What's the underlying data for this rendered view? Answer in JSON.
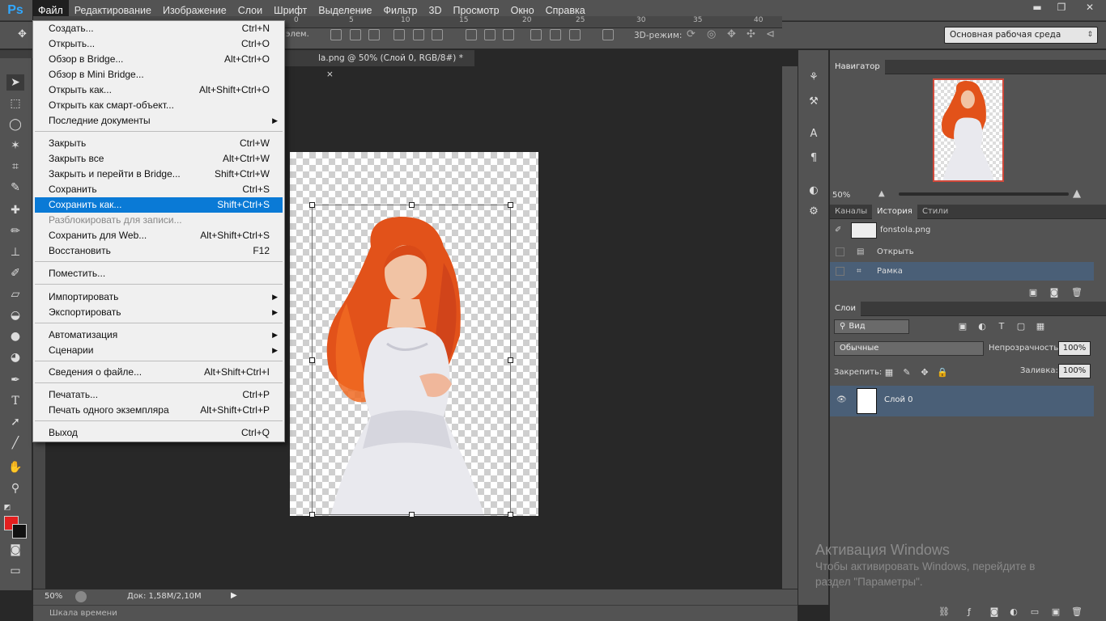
{
  "app": {
    "logo": "Ps"
  },
  "menubar": {
    "items": [
      "Файл",
      "Редактирование",
      "Изображение",
      "Слои",
      "Шрифт",
      "Выделение",
      "Фильтр",
      "3D",
      "Просмотр",
      "Окно",
      "Справка"
    ],
    "active_index": 0
  },
  "window_controls": {
    "minimize": "▬",
    "restore": "❐",
    "close": "✕"
  },
  "options_bar": {
    "elem_label": "элем.",
    "mode_3d_label": "3D-режим:",
    "workspace": "Основная рабочая среда"
  },
  "document": {
    "tab_title": "la.png @ 50% (Слой 0, RGB/8#) *",
    "tab_close": "×"
  },
  "rulers": {
    "h_ticks": [
      "0",
      "5",
      "10",
      "15",
      "20",
      "25",
      "30",
      "35",
      "40"
    ]
  },
  "status": {
    "zoom": "50%",
    "doc_info": "Док: 1,58M/2,10M"
  },
  "timeline": {
    "label": "Шкала времени"
  },
  "file_menu": {
    "items": [
      {
        "label": "Создать...",
        "shortcut": "Ctrl+N"
      },
      {
        "label": "Открыть...",
        "shortcut": "Ctrl+O"
      },
      {
        "label": "Обзор в Bridge...",
        "shortcut": "Alt+Ctrl+O"
      },
      {
        "label": "Обзор в Mini Bridge...",
        "shortcut": ""
      },
      {
        "label": "Открыть как...",
        "shortcut": "Alt+Shift+Ctrl+O"
      },
      {
        "label": "Открыть как смарт-объект...",
        "shortcut": ""
      },
      {
        "label": "Последние документы",
        "shortcut": "",
        "submenu": true
      },
      {
        "label": "Закрыть",
        "shortcut": "Ctrl+W"
      },
      {
        "label": "Закрыть все",
        "shortcut": "Alt+Ctrl+W"
      },
      {
        "label": "Закрыть и перейти в Bridge...",
        "shortcut": "Shift+Ctrl+W"
      },
      {
        "label": "Сохранить",
        "shortcut": "Ctrl+S"
      },
      {
        "label": "Сохранить как...",
        "shortcut": "Shift+Ctrl+S",
        "highlighted": true
      },
      {
        "label": "Разблокировать для записи...",
        "shortcut": "",
        "disabled": true
      },
      {
        "label": "Сохранить для Web...",
        "shortcut": "Alt+Shift+Ctrl+S"
      },
      {
        "label": "Восстановить",
        "shortcut": "F12"
      },
      {
        "label": "Поместить...",
        "shortcut": ""
      },
      {
        "label": "Импортировать",
        "shortcut": "",
        "submenu": true
      },
      {
        "label": "Экспортировать",
        "shortcut": "",
        "submenu": true
      },
      {
        "label": "Автоматизация",
        "shortcut": "",
        "submenu": true
      },
      {
        "label": "Сценарии",
        "shortcut": "",
        "submenu": true
      },
      {
        "label": "Сведения о файле...",
        "shortcut": "Alt+Shift+Ctrl+I"
      },
      {
        "label": "Печатать...",
        "shortcut": "Ctrl+P"
      },
      {
        "label": "Печать одного экземпляра",
        "shortcut": "Alt+Shift+Ctrl+P"
      },
      {
        "label": "Выход",
        "shortcut": "Ctrl+Q"
      }
    ],
    "submenu_arrow": "▶"
  },
  "navigator": {
    "title": "Навигатор",
    "zoom": "50%"
  },
  "history_panel": {
    "tabs": [
      "Каналы",
      "История",
      "Стили"
    ],
    "active_tab": 1,
    "snapshot": "fonstola.png",
    "items": [
      "Открыть",
      "Рамка"
    ]
  },
  "layers_panel": {
    "title": "Слои",
    "filter": "Вид",
    "blend_mode": "Обычные",
    "opacity_label": "Непрозрачность:",
    "opacity_value": "100%",
    "lock_label": "Закрепить:",
    "fill_label": "Заливка:",
    "fill_value": "100%",
    "layers": [
      "Слой 0"
    ]
  },
  "windows_activation": {
    "title": "Активация Windows",
    "line1": "Чтобы активировать Windows, перейдите в",
    "line2": "раздел \"Параметры\"."
  },
  "colors": {
    "foreground": "#e31f1f",
    "background": "#111111",
    "menu_highlight": "#0a7ad6"
  }
}
